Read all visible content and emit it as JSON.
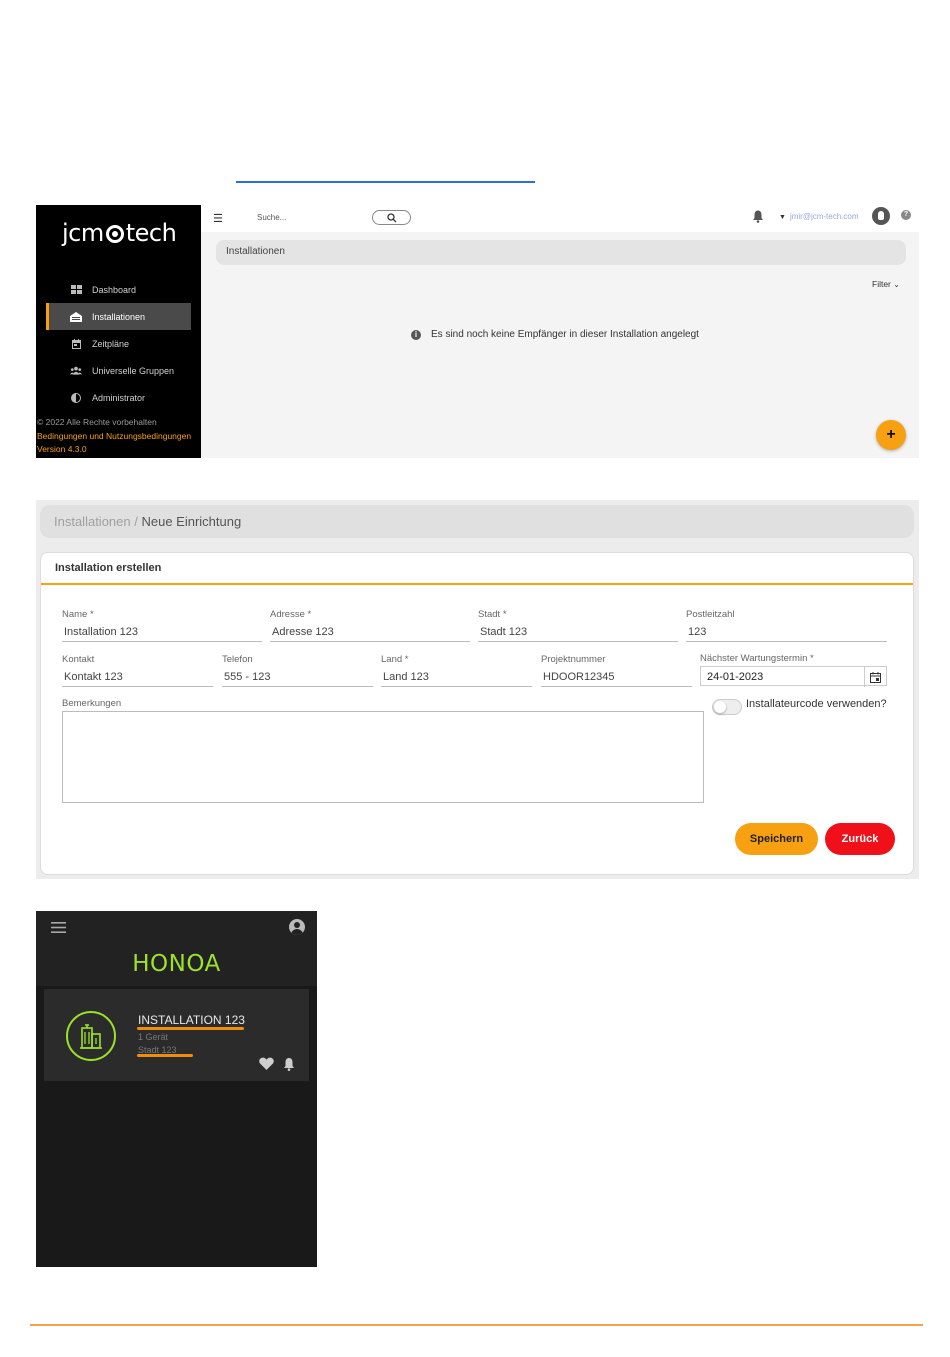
{
  "app": {
    "logo": {
      "left": "jcm",
      "right": "tech"
    },
    "sidebar": {
      "items": [
        {
          "label": "Dashboard",
          "icon": "grid-icon",
          "active": false
        },
        {
          "label": "Installationen",
          "icon": "building-icon",
          "active": true
        },
        {
          "label": "Zeitpläne",
          "icon": "calendar-icon",
          "active": false
        },
        {
          "label": "Universelle Gruppen",
          "icon": "group-icon",
          "active": false
        },
        {
          "label": "Administrator",
          "icon": "contrast-icon",
          "active": false
        }
      ],
      "footer": {
        "copyright": "© 2022 Alle Rechte vorbehalten",
        "terms": "Bedingungen und Nutzungsbedingungen",
        "version": "Version 4.3.0"
      }
    },
    "topbar": {
      "search_placeholder": "Suche...",
      "user_email": "jmir@jcm-tech.com"
    },
    "breadcrumb": "Installationen",
    "filter_label": "Filter",
    "empty_message": "Es sind noch keine Empfänger in dieser Installation angelegt",
    "fab_label": "+"
  },
  "form": {
    "breadcrumb": {
      "parent": "Installationen",
      "separator": " / ",
      "current": "Neue Einrichtung"
    },
    "title": "Installation erstellen",
    "fields": {
      "name": {
        "label": "Name *",
        "value": "Installation 123"
      },
      "address": {
        "label": "Adresse *",
        "value": "Adresse 123"
      },
      "city": {
        "label": "Stadt *",
        "value": "Stadt 123"
      },
      "zip": {
        "label": "Postleitzahl",
        "value": "123"
      },
      "contact": {
        "label": "Kontakt",
        "value": "Kontakt 123"
      },
      "phone": {
        "label": "Telefon",
        "value": "555 - 123"
      },
      "country": {
        "label": "Land *",
        "value": "Land 123"
      },
      "project": {
        "label": "Projektnummer",
        "value": "HDOOR12345"
      },
      "maintenance": {
        "label": "Nächster Wartungstermin *",
        "value": "24-01-2023"
      },
      "remarks": {
        "label": "Bemerkungen",
        "value": ""
      }
    },
    "toggle_label": "Installateurcode verwenden?",
    "toggle_on": false,
    "save_label": "Speichern",
    "back_label": "Zurück"
  },
  "mobile": {
    "title": "HONOA",
    "installation": {
      "name": "INSTALLATION 123",
      "devices": "1 Gerät",
      "city": "Stadt 123"
    }
  },
  "colors": {
    "accent": "#f7a012",
    "danger": "#f0101a",
    "mobile_accent": "#9be22a",
    "link_line": "#2a6fd6"
  }
}
